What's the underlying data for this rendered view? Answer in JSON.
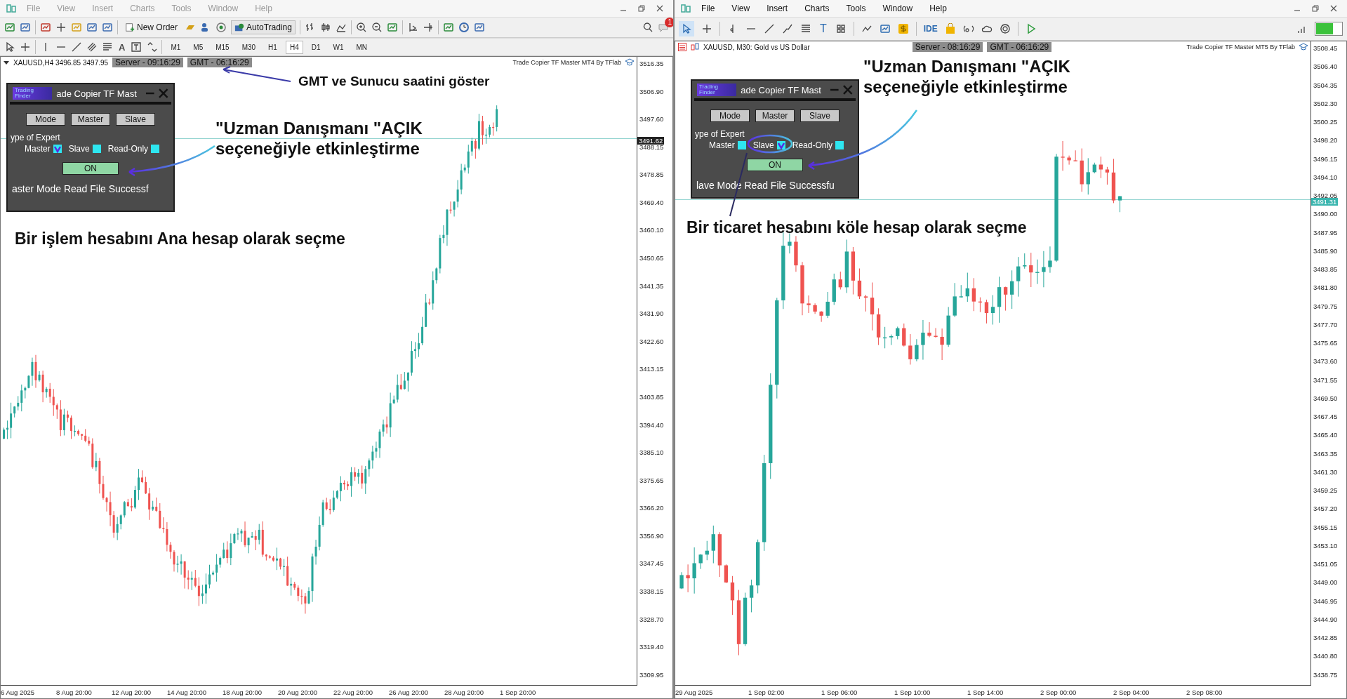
{
  "windows": [
    {
      "kind": "mt4",
      "active": false,
      "menu": [
        "File",
        "View",
        "Insert",
        "Charts",
        "Tools",
        "Window",
        "Help"
      ],
      "toolbar": {
        "new_order": "New Order",
        "auto_trading": "AutoTrading",
        "notification_count": "1",
        "text_tool": "A",
        "timeframes": [
          {
            "label": "M1",
            "selected": false
          },
          {
            "label": "M5",
            "selected": false
          },
          {
            "label": "M15",
            "selected": false
          },
          {
            "label": "M30",
            "selected": false
          },
          {
            "label": "H1",
            "selected": false
          },
          {
            "label": "H4",
            "selected": true
          },
          {
            "label": "D1",
            "selected": false
          },
          {
            "label": "W1",
            "selected": false
          },
          {
            "label": "MN",
            "selected": false
          }
        ]
      },
      "chart": {
        "symbol": "XAUUSD,H4  3496.85 3497.95",
        "server_time": "Server - 09:16:29",
        "gmt_time": "GMT - 06:16:29",
        "expert_name": "Trade Copier TF Master MT4 By TFlab",
        "price_axis": [
          "3516.35",
          "3506.90",
          "3497.60",
          "3488.15",
          "3478.85",
          "3469.40",
          "3460.10",
          "3450.65",
          "3441.35",
          "3431.90",
          "3422.60",
          "3413.15",
          "3403.85",
          "3394.40",
          "3385.10",
          "3375.65",
          "3366.20",
          "3356.90",
          "3347.45",
          "3338.15",
          "3328.70",
          "3319.40",
          "3309.95"
        ],
        "current_price": "3491.62",
        "time_axis": [
          "6 Aug 2025",
          "8 Aug 20:00",
          "12 Aug 20:00",
          "14 Aug 20:00",
          "18 Aug 20:00",
          "20 Aug 20:00",
          "22 Aug 20:00",
          "26 Aug 20:00",
          "28 Aug 20:00",
          "1 Sep 20:00"
        ],
        "panel": {
          "logo": "Trading Finder",
          "title": "ade Copier TF Mast",
          "buttons": [
            "Mode",
            "Master",
            "Slave"
          ],
          "type_label": "ype of Expert",
          "options": [
            {
              "label": "Master",
              "checked": true
            },
            {
              "label": "Slave",
              "checked": false
            },
            {
              "label": "Read-Only",
              "checked": false
            }
          ],
          "on_button": "ON",
          "status": "aster Mode Read File Successf"
        },
        "annotations": [
          "GMT ve Sunucu saatini göster",
          "\"Uzman Danışmanı \"AÇIK seçeneğiyle etkinleştirme",
          "Bir işlem hesabını Ana hesap olarak seçme"
        ]
      }
    },
    {
      "kind": "mt5",
      "active": true,
      "menu": [
        "File",
        "View",
        "Insert",
        "Charts",
        "Tools",
        "Window",
        "Help"
      ],
      "toolbar": {
        "ide_label": "IDE",
        "text_tool": "T"
      },
      "chart": {
        "symbol": "XAUUSD, M30:  Gold vs US Dollar",
        "server_time": "Server - 08:16:29",
        "gmt_time": "GMT - 06:16:29",
        "expert_name": "Trade Copier TF Master MT5 By TFlab",
        "price_axis": [
          "3508.45",
          "3506.40",
          "3504.35",
          "3502.30",
          "3500.25",
          "3498.20",
          "3496.15",
          "3494.10",
          "3492.05",
          "3490.00",
          "3487.95",
          "3485.90",
          "3483.85",
          "3481.80",
          "3479.75",
          "3477.70",
          "3475.65",
          "3473.60",
          "3471.55",
          "3469.50",
          "3467.45",
          "3465.40",
          "3463.35",
          "3461.30",
          "3459.25",
          "3457.20",
          "3455.15",
          "3453.10",
          "3451.05",
          "3449.00",
          "3446.95",
          "3444.90",
          "3442.85",
          "3440.80",
          "3438.75"
        ],
        "current_price": "3491.31",
        "time_axis": [
          "29 Aug 2025",
          "1 Sep 02:00",
          "1 Sep 06:00",
          "1 Sep 10:00",
          "1 Sep 14:00",
          "2 Sep 00:00",
          "2 Sep 04:00",
          "2 Sep 08:00"
        ],
        "panel": {
          "logo": "Trading Finder",
          "title": "ade Copier TF Mast",
          "buttons": [
            "Mode",
            "Master",
            "Slave"
          ],
          "type_label": "ype of Expert",
          "options": [
            {
              "label": "Master",
              "checked": false
            },
            {
              "label": "Slave",
              "checked": true
            },
            {
              "label": "Read-Only",
              "checked": false
            }
          ],
          "on_button": "ON",
          "status": "lave Mode Read File Successfu"
        },
        "annotations": [
          "\"Uzman Danışmanı \"AÇIK seçeneğiyle etkinleştirme",
          "Bir ticaret hesabını köle hesap olarak seçme"
        ]
      }
    }
  ]
}
